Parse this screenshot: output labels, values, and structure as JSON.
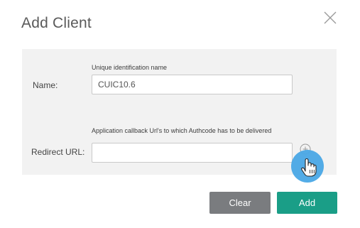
{
  "dialog": {
    "title": "Add Client",
    "close_icon": "close-icon"
  },
  "form": {
    "name": {
      "hint": "Unique identification name",
      "label": "Name:",
      "value": "CUIC10.6"
    },
    "redirect": {
      "hint": "Application callback Url's to which Authcode has to be delivered",
      "label": "Redirect URL:",
      "value": "",
      "add_icon": "plus-circle-icon"
    }
  },
  "buttons": {
    "clear_label": "Clear",
    "add_label": "Add"
  },
  "colors": {
    "panel_background": "#f2f2f2",
    "clear_button": "#7a7c7f",
    "add_button": "#1a9e87",
    "cursor_highlight": "#4aa8e6"
  }
}
